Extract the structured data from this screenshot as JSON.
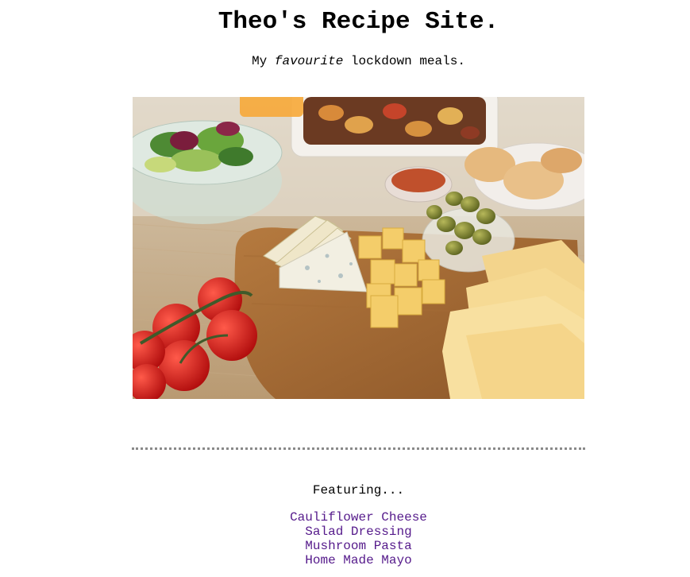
{
  "header": {
    "title": "Theo's Recipe Site.",
    "tagline_before": "My ",
    "tagline_emphasis": "favourite",
    "tagline_after": " lockdown meals."
  },
  "hero_image": {
    "icon": "food-platter-image"
  },
  "featuring": {
    "heading": "Featuring...",
    "recipes": [
      {
        "label": "Cauliflower Cheese"
      },
      {
        "label": "Salad Dressing"
      },
      {
        "label": "Mushroom Pasta"
      },
      {
        "label": "Home Made Mayo"
      }
    ]
  },
  "colors": {
    "link_visited": "#551a8b",
    "divider": "#8a8a8a"
  }
}
